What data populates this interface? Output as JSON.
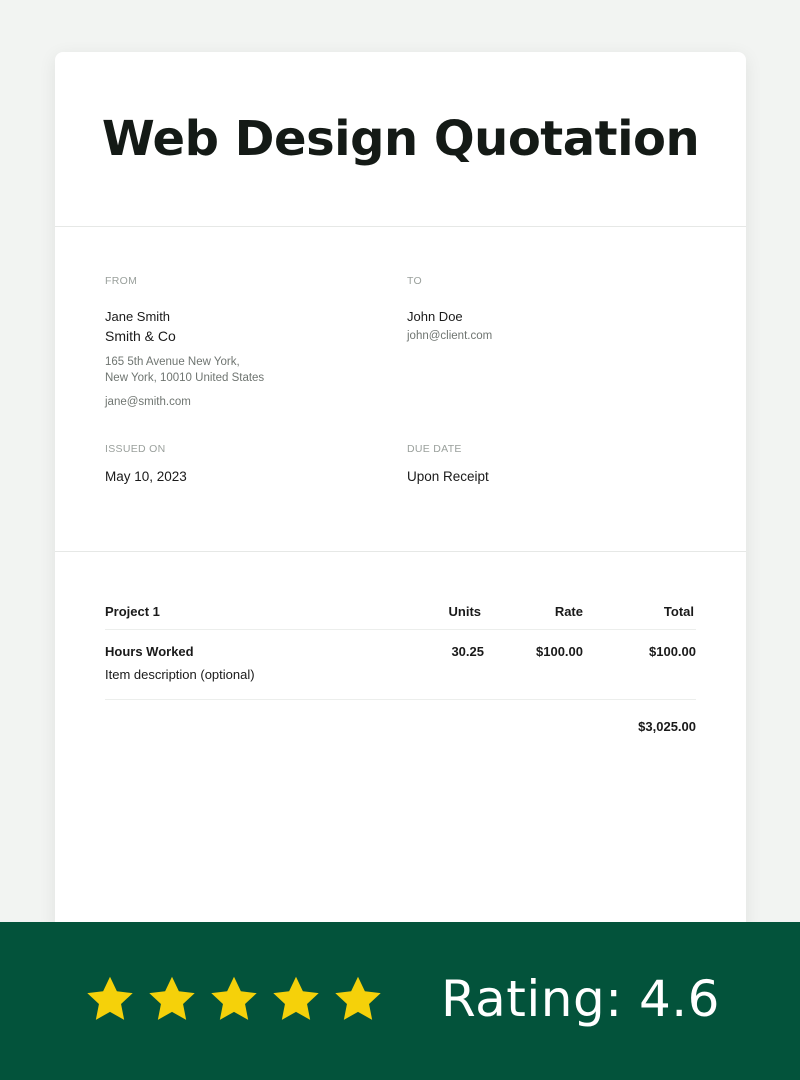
{
  "title": "Web Design Quotation",
  "from": {
    "label": "FROM",
    "name": "Jane Smith",
    "company": "Smith & Co",
    "address_line1": "165 5th Avenue New York,",
    "address_line2": "New York, 10010 United States",
    "email": "jane@smith.com"
  },
  "to": {
    "label": "TO",
    "name": "John Doe",
    "email": "john@client.com"
  },
  "issued": {
    "label": "ISSUED ON",
    "value": "May 10, 2023"
  },
  "due": {
    "label": "DUE DATE",
    "value": "Upon Receipt"
  },
  "table": {
    "headers": {
      "project": "Project 1",
      "units": "Units",
      "rate": "Rate",
      "total": "Total"
    },
    "rows": [
      {
        "name": "Hours Worked",
        "description": "Item description (optional)",
        "units": "30.25",
        "rate": "$100.00",
        "total": "$100.00"
      }
    ],
    "grand_total": "$3,025.00"
  },
  "footer": {
    "rating_text": "Rating: 4.6",
    "stars": 5,
    "star_color": "#f5d10a",
    "background": "#03533b"
  }
}
